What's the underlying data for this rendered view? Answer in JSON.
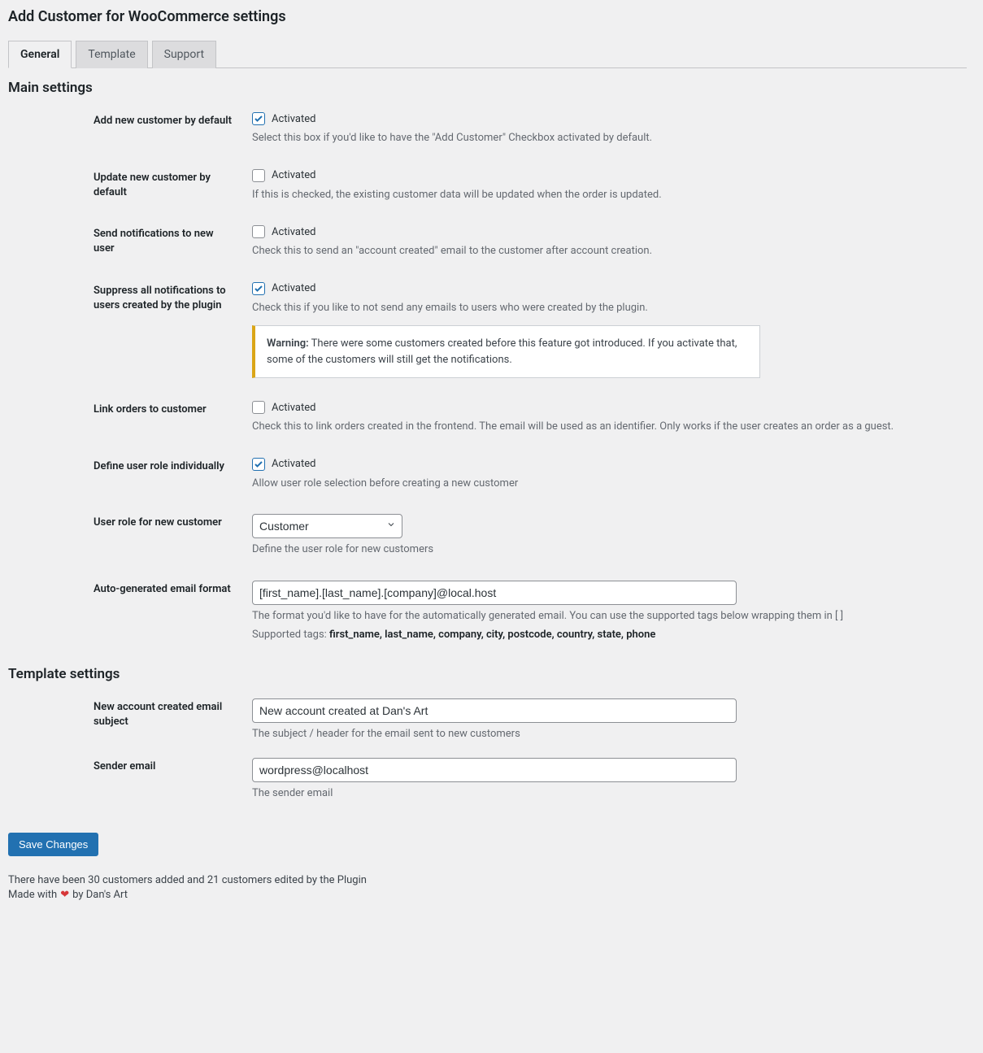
{
  "page_title": "Add Customer for WooCommerce settings",
  "tabs": {
    "general": "General",
    "template": "Template",
    "support": "Support"
  },
  "sections": {
    "main": "Main settings",
    "template": "Template settings"
  },
  "checkbox_label": "Activated",
  "fields": {
    "add_default": {
      "label": "Add new customer by default",
      "checked": true,
      "desc": "Select this box if you'd like to have the \"Add Customer\" Checkbox activated by default."
    },
    "update_default": {
      "label": "Update new customer by default",
      "checked": false,
      "desc": "If this is checked, the existing customer data will be updated when the order is updated."
    },
    "send_notifications": {
      "label": "Send notifications to new user",
      "checked": false,
      "desc": "Check this to send an \"account created\" email to the customer after account creation."
    },
    "suppress_notifications": {
      "label": "Suppress all notifications to users created by the plugin",
      "checked": true,
      "desc": "Check this if you like to not send any emails to users who were created by the plugin.",
      "warning_label": "Warning:",
      "warning_text": " There were some customers created before this feature got introduced. If you activate that, some of the customers will still get the notifications."
    },
    "link_orders": {
      "label": "Link orders to customer",
      "checked": false,
      "desc": "Check this to link orders created in the frontend. The email will be used as an identifier. Only works if the user creates an order as a guest."
    },
    "define_role": {
      "label": "Define user role individually",
      "checked": true,
      "desc": "Allow user role selection before creating a new customer"
    },
    "user_role": {
      "label": "User role for new customer",
      "value": "Customer",
      "desc": "Define the user role for new customers"
    },
    "email_format": {
      "label": "Auto-generated email format",
      "value": "[first_name].[last_name].[company]@local.host",
      "desc": "The format you'd like to have for the automatically generated email. You can use the supported tags below wrapping them in [ ]",
      "tags_label": "Supported tags: ",
      "tags": "first_name, last_name, company, city, postcode, country, state, phone"
    },
    "email_subject": {
      "label": "New account created email subject",
      "value": "New account created at Dan's Art",
      "desc": "The subject / header for the email sent to new customers"
    },
    "sender_email": {
      "label": "Sender email",
      "value": "wordpress@localhost",
      "desc": "The sender email"
    }
  },
  "save_button": "Save Changes",
  "footer_stats": "There have been 30 customers added and 21 customers edited by the Plugin",
  "footer_made_pre": "Made with",
  "footer_made_post": "by Dan's Art"
}
